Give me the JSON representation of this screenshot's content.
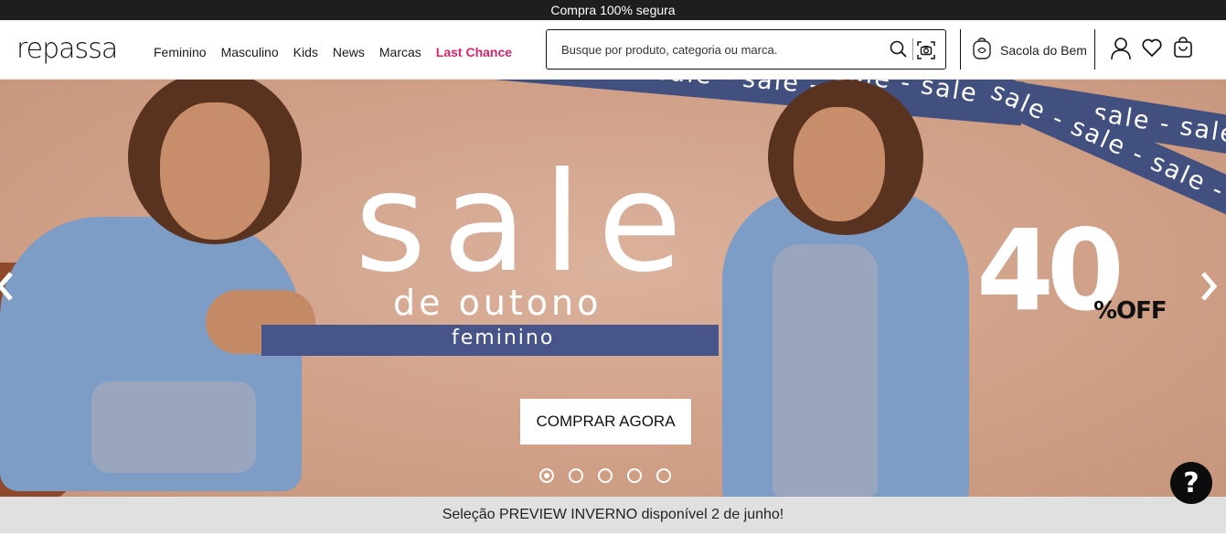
{
  "topbar": {
    "text": "Compra 100% segura"
  },
  "header": {
    "logo": "repassa",
    "nav": [
      {
        "label": "Feminino"
      },
      {
        "label": "Masculino"
      },
      {
        "label": "Kids"
      },
      {
        "label": "News"
      },
      {
        "label": "Marcas"
      },
      {
        "label": "Last Chance",
        "color": "#d6246e"
      }
    ],
    "search": {
      "placeholder": "Busque por produto, categoria ou marca.",
      "value": "",
      "icons": [
        "search-icon",
        "camera-icon"
      ]
    },
    "sacola": {
      "label": "Sacola do Bem",
      "icon": "backpack-icon"
    },
    "actions": [
      "user-icon",
      "heart-icon",
      "bag-icon"
    ]
  },
  "hero": {
    "headline": "sale",
    "subheadline": "de outono",
    "category": "feminino",
    "discount": "40",
    "discount_suffix": "%OFF",
    "cta_label": "COMPRAR AGORA",
    "stripe_text": "sale - sale - sale - sale - sale - sale - sale - sale",
    "slides_total": 5,
    "active_slide": 1,
    "colors": {
      "stripe": "#42507f",
      "background": "#d7ab93"
    }
  },
  "help": {
    "label": "?"
  },
  "announcement": {
    "text": "Seleção PREVIEW INVERNO disponível 2 de junho!"
  }
}
